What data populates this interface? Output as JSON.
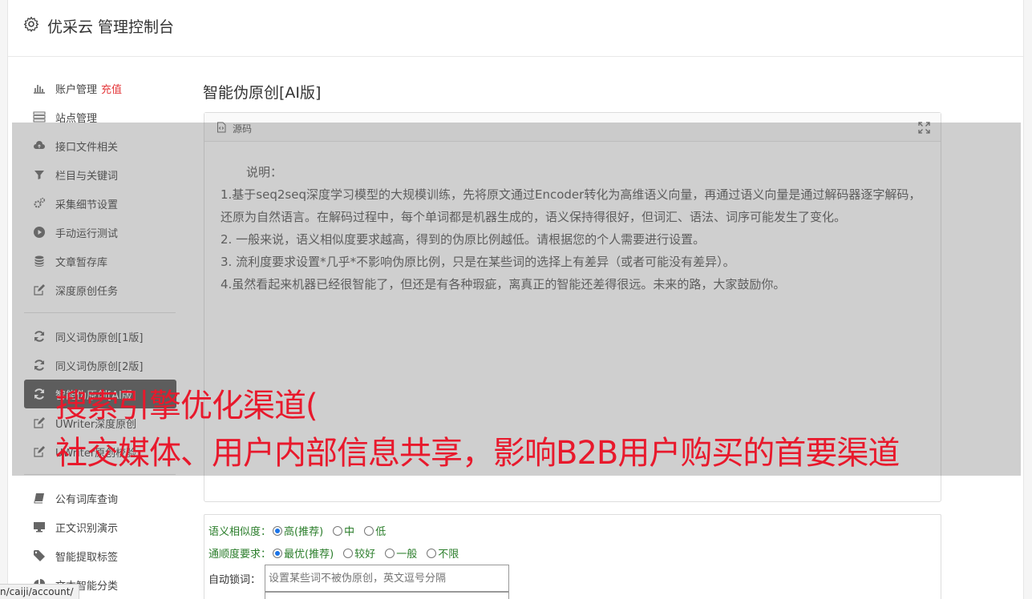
{
  "header": {
    "title": "优采云 管理控制台"
  },
  "sidebar": {
    "group1": [
      {
        "icon": "bar-chart-icon",
        "label": "账户管理",
        "badge": "充值"
      },
      {
        "icon": "server-icon",
        "label": "站点管理"
      },
      {
        "icon": "cloud-upload-icon",
        "label": "接口文件相关"
      },
      {
        "icon": "filter-icon",
        "label": "栏目与关键词"
      },
      {
        "icon": "gears-icon",
        "label": "采集细节设置"
      },
      {
        "icon": "play-circle-icon",
        "label": "手动运行测试"
      },
      {
        "icon": "database-icon",
        "label": "文章暂存库"
      },
      {
        "icon": "edit-icon",
        "label": "深度原创任务"
      }
    ],
    "group2": [
      {
        "icon": "refresh-icon",
        "label": "同义词伪原创[1版]"
      },
      {
        "icon": "refresh-icon",
        "label": "同义词伪原创[2版]"
      },
      {
        "icon": "refresh-icon",
        "label": "智能伪原创[AI版]",
        "active": true
      },
      {
        "icon": "edit-icon",
        "label": "UWriter深度原创"
      },
      {
        "icon": "edit-icon",
        "label": "UWriter原创校验"
      }
    ],
    "group3": [
      {
        "icon": "book-icon",
        "label": "公有词库查询"
      },
      {
        "icon": "desktop-icon",
        "label": "正文识别演示"
      },
      {
        "icon": "tag-icon",
        "label": "智能提取标签"
      },
      {
        "icon": "pie-chart-icon",
        "label": "文本智能分类"
      }
    ]
  },
  "main": {
    "title": "智能伪原创[AI版]",
    "source_panel": {
      "label": "源码",
      "intro": "说明：",
      "lines": [
        "1.基于seq2seq深度学习模型的大规模训练，先将原文通过Encoder转化为高维语义向量，再通过语义向量是通过解码器逐字解码，还原为自然语言。在解码过程中，每个单词都是机器生成的，语义保持得很好，但词汇、语法、词序可能发生了变化。",
        "2. 一般来说，语义相似度要求越高，得到的伪原比例越低。请根据您的个人需要进行设置。",
        "3. 流利度要求设置*几乎*不影响伪原比例，只是在某些词的选择上有差异（或者可能没有差异）。",
        "4.虽然看起来机器已经很智能了，但还是有各种瑕疵，离真正的智能还差得很远。未来的路，大家鼓励你。"
      ]
    },
    "options": {
      "similarity": {
        "label": "语义相似度：",
        "choices": [
          "高(推荐)",
          "中",
          "低"
        ],
        "selected": 0
      },
      "fluency": {
        "label": "通顺度要求：",
        "choices": [
          "最优(推荐)",
          "较好",
          "一般",
          "不限"
        ],
        "selected": 0
      },
      "lock_words": {
        "label": "自动锁词：",
        "placeholder": "设置某些词不被伪原创，英文逗号分隔"
      }
    }
  },
  "overlay": {
    "line1": "搜索引擎优化渠道(",
    "line2": "社交媒体、用户内部信息共享，影响B2B用户购买的首要渠道"
  },
  "status_bar": {
    "url": "n/caiji/account/"
  }
}
